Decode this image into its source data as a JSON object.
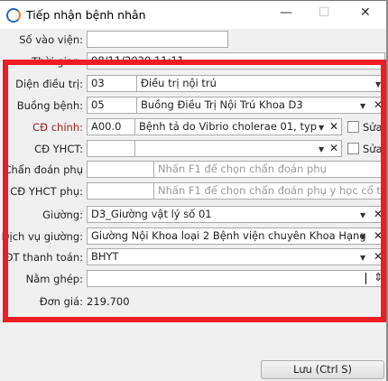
{
  "window": {
    "title": "Tiếp nhận bệnh nhân",
    "minimize": "—",
    "maximize": "☐",
    "close": "✕"
  },
  "fields": {
    "so_vao_vien": {
      "label": "Số vào viện:",
      "value": ""
    },
    "thoi_gian": {
      "label": "Thời gian:",
      "value": "08/11/2020 11:11"
    },
    "dien_dieu_tri": {
      "label": "Diện điều trị:",
      "code": "03",
      "value": "Điều trị nội trú"
    },
    "buong_benh": {
      "label": "Buồng bệnh:",
      "code": "05",
      "value": "Buồng Điều Trị Nội Trú Khoa D3"
    },
    "cd_chinh": {
      "label": "CĐ chính:",
      "code": "A00.0",
      "value": "Bệnh tả do Vibrio cholerae 01, typ",
      "edit_label": "Sửa",
      "edit_checked": false
    },
    "cd_yhct": {
      "label": "CĐ YHCT:",
      "code": "",
      "value": "",
      "edit_label": "Sửa",
      "edit_checked": false
    },
    "chan_doan_phu": {
      "label": "Chẩn đoán phụ",
      "code": "",
      "placeholder": "Nhấn F1 để chọn chẩn đoán phụ"
    },
    "cd_yhct_phu": {
      "label": "CĐ YHCT phụ:",
      "code": "",
      "placeholder": "Nhấn F1 để chọn chẩn đoán phụ y học cổ tr"
    },
    "giuong": {
      "label": "Giường:",
      "value": "D3_Giường vật lý số 01"
    },
    "dich_vu_giuong": {
      "label": "Dịch vụ giường:",
      "value": "Giường Nội Khoa loại 2 Bệnh viện chuyên Khoa Hạng"
    },
    "dt_thanh_toan": {
      "label": "ĐT thanh toán:",
      "value": "BHYT"
    },
    "nam_ghep": {
      "label": "Nằm ghép:",
      "value": ""
    },
    "don_gia": {
      "label": "Đơn giá:",
      "value": "219.700"
    }
  },
  "icons": {
    "dropdown": "▼",
    "clear": "✕",
    "spinner": "⇕"
  },
  "save_button": "Lưu (Ctrl S)",
  "colors": {
    "highlight": "#ee1c25",
    "required_label": "#9b1b1b"
  }
}
